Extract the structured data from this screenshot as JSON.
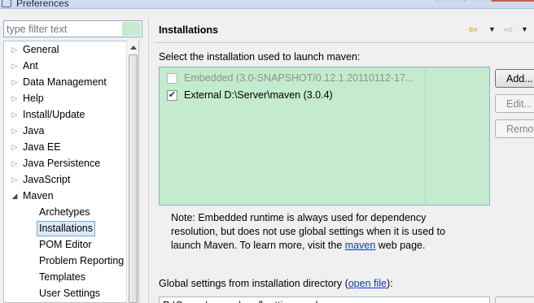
{
  "window": {
    "title": "Preferences"
  },
  "filter": {
    "placeholder": "type filter text"
  },
  "tree": {
    "items": [
      {
        "label": "General",
        "expanded": false
      },
      {
        "label": "Ant",
        "expanded": false
      },
      {
        "label": "Data Management",
        "expanded": false
      },
      {
        "label": "Help",
        "expanded": false
      },
      {
        "label": "Install/Update",
        "expanded": false
      },
      {
        "label": "Java",
        "expanded": false
      },
      {
        "label": "Java EE",
        "expanded": false
      },
      {
        "label": "Java Persistence",
        "expanded": false
      },
      {
        "label": "JavaScript",
        "expanded": false
      },
      {
        "label": "Maven",
        "expanded": true
      }
    ],
    "maven_children": [
      {
        "label": "Archetypes"
      },
      {
        "label": "Installations",
        "selected": true
      },
      {
        "label": "POM Editor"
      },
      {
        "label": "Problem Reporting"
      },
      {
        "label": "Templates"
      },
      {
        "label": "User Settings"
      }
    ]
  },
  "page": {
    "title": "Installations",
    "select_label": "Select the installation used to launch maven:",
    "installations": [
      {
        "label": "Embedded (3.0-SNAPSHOT/0.12.1.20110112-17...",
        "checked": false,
        "enabled": false
      },
      {
        "label": "External D:\\Server\\maven (3.0.4)",
        "checked": true,
        "enabled": true
      }
    ],
    "buttons": {
      "add": "Add...",
      "edit": "Edit...",
      "remove": "Remove"
    },
    "note_text_1": "Note: Embedded runtime is always used for dependency",
    "note_text_2": "resolution, but does not use global settings when it is used to",
    "note_text_3": "launch Maven. To learn more, visit the ",
    "note_link": "maven",
    "note_text_4": " web page.",
    "global_label_1": "Global settings from installation directory (",
    "global_link": "open file",
    "global_label_2": "):",
    "global_value": "D:\\Server\\maven\\conf\\settings.xml"
  },
  "icons": {
    "back": "back-arrow-icon",
    "forward": "forward-arrow-icon",
    "menu": "dropdown-triangle-icon"
  },
  "colors": {
    "table_bg": "#c4ebce",
    "link": "#0e36c8",
    "selection": "#dceaf8"
  }
}
